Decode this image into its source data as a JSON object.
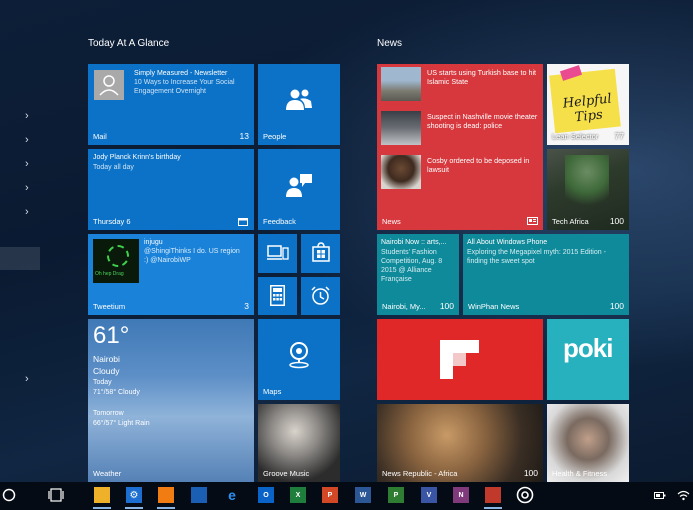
{
  "groups": {
    "left_title": "Today At A Glance",
    "right_title": "News"
  },
  "mail": {
    "sender": "Simply Measured - Newsletter",
    "subject": "10 Ways to Increase Your Social Engagement Overnight",
    "label": "Mail",
    "count": "13"
  },
  "people": {
    "label": "People"
  },
  "calendar": {
    "event": "Jody Planck Krinn's birthday",
    "time": "Today all day",
    "label": "Thursday 6"
  },
  "feedback": {
    "label": "Feedback"
  },
  "tweetium": {
    "user": "injugu",
    "text": "@ShingiThinks I do. US region :) @NairobiWP",
    "img_text": "Oh hep Drag",
    "label": "Tweetium",
    "count": "3"
  },
  "weather": {
    "temp": "61°",
    "city": "Nairobi",
    "cond": "Cloudy",
    "today": "Today",
    "today_range": "71°/58° Cloudy",
    "tomorrow": "Tomorrow",
    "tomorrow_range": "66°/57° Light Rain",
    "label": "Weather"
  },
  "maps": {
    "label": "Maps"
  },
  "groove": {
    "label": "Groove Music"
  },
  "news": {
    "items": [
      "US starts using Turkish base to hit Islamic State",
      "Suspect in Nashville movie theater shooting is dead: police",
      "Cosby ordered to be deposed in lawsuit"
    ],
    "label": "News"
  },
  "helpful": {
    "note": "Helpful Tips",
    "label": "Lean Selector",
    "count": "77"
  },
  "techafrica": {
    "label": "Tech Africa",
    "count": "100"
  },
  "nairobi_now": {
    "title": "Nairobi Now :: arts,...",
    "text": "Students' Fashion Competition, Aug. 8 2015 @ Alliance Française",
    "label": "Nairobi, My...",
    "count": "100"
  },
  "winphan": {
    "title": "All About Windows Phone",
    "text": "Exploring the Megapixel myth: 2015 Edition - finding the sweet spot",
    "label": "WinPhan News",
    "count": "100"
  },
  "poki": {
    "text": "poki"
  },
  "newsrepublic": {
    "label": "News Republic - Africa",
    "count": "100"
  },
  "health": {
    "label": "Health & Fitness"
  },
  "taskbar": {
    "excel": "X",
    "word": "W",
    "ppt": "P",
    "project": "P",
    "visio": "V",
    "onenote": "N",
    "outlook": "O"
  },
  "colors": {
    "tile_blue": "#0b72c7",
    "tile_teal": "#0f8a9b",
    "tile_red": "#d6383e",
    "flipboard_red": "#e12828",
    "poki_teal": "#27b1bf"
  }
}
